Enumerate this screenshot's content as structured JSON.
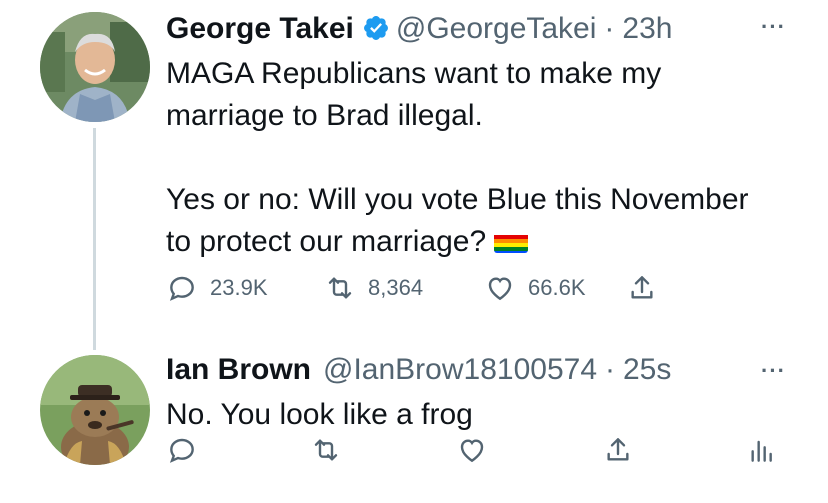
{
  "tweet1": {
    "display_name": "George Takei",
    "handle": "@GeorgeTakei",
    "separator": "·",
    "time": "23h",
    "more": "···",
    "text_line1": "MAGA Republicans want to make my",
    "text_line2": "marriage to Brad illegal.",
    "text_line3": "Yes or no: Will you vote Blue this November",
    "text_line4": "to protect our marriage?",
    "emoji": "rainbow-flag",
    "stats": {
      "replies": "23.9K",
      "retweets": "8,364",
      "likes": "66.6K"
    }
  },
  "tweet2": {
    "display_name": "Ian Brown",
    "handle": "@IanBrow18100574",
    "separator": "·",
    "time": "25s",
    "more": "···",
    "text": "No. You look like a frog"
  },
  "colors": {
    "verified_blue": "#1d9bf0",
    "muted_text": "#536471",
    "thread_line": "#cfd9de"
  }
}
